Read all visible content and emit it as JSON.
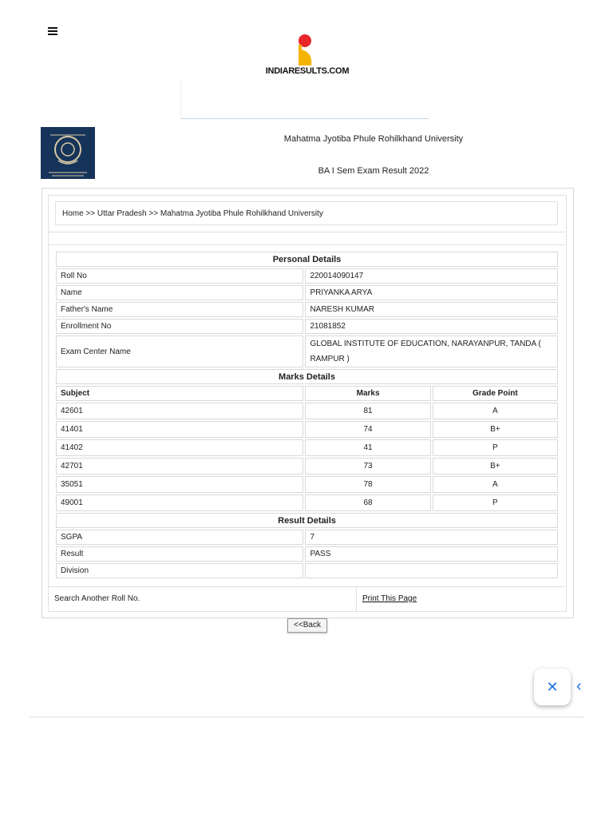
{
  "header": {
    "logo_text": "INDIARESULTS.COM"
  },
  "university": {
    "name": "Mahatma Jyotiba Phule Rohilkhand University",
    "exam_title": "BA I Sem Exam Result 2022"
  },
  "breadcrumb": "Home >> Uttar Pradesh >> Mahatma Jyotiba Phule Rohilkhand University",
  "personal": {
    "heading": "Personal Details",
    "rows": [
      {
        "label": "Roll No",
        "value": "220014090147"
      },
      {
        "label": "Name",
        "value": "PRIYANKA ARYA"
      },
      {
        "label": "Father's Name",
        "value": "NARESH KUMAR"
      },
      {
        "label": "Enrollment No",
        "value": "21081852"
      },
      {
        "label": "Exam Center Name",
        "value": "GLOBAL INSTITUTE OF EDUCATION, NARAYANPUR, TANDA ( RAMPUR )"
      }
    ]
  },
  "marks": {
    "heading": "Marks Details",
    "columns": [
      "Subject",
      "Marks",
      "Grade Point"
    ],
    "rows": [
      {
        "subject": "42601",
        "marks": "81",
        "grade": "A"
      },
      {
        "subject": "41401",
        "marks": "74",
        "grade": "B+"
      },
      {
        "subject": "41402",
        "marks": "41",
        "grade": "P"
      },
      {
        "subject": "42701",
        "marks": "73",
        "grade": "B+"
      },
      {
        "subject": "35051",
        "marks": "78",
        "grade": "A"
      },
      {
        "subject": "49001",
        "marks": "68",
        "grade": "P"
      }
    ]
  },
  "result": {
    "heading": "Result Details",
    "rows": [
      {
        "label": "SGPA",
        "value": "7"
      },
      {
        "label": "Result",
        "value": "PASS"
      },
      {
        "label": "Division",
        "value": ""
      }
    ]
  },
  "footer": {
    "search_label": "Search Another Roll No.",
    "print_label": "Print This Page",
    "back_label": "<<Back"
  },
  "icons": {
    "menu": "hamburger-menu-icon",
    "close": "close-icon",
    "chevron": "chevron-left-icon",
    "close_glyph": "✕",
    "chevron_glyph": "‹"
  },
  "colors": {
    "accent": "#1a73e8",
    "logo_red": "#e8262a",
    "logo_yellow": "#f5b400",
    "uni_logo_bg": "#16345a"
  }
}
